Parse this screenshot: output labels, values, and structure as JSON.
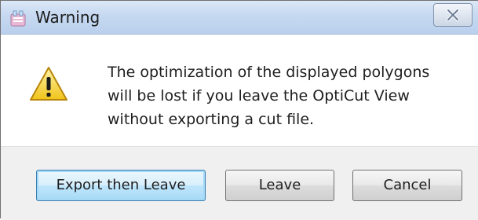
{
  "dialog": {
    "title": "Warning",
    "title_icon": "app-icon",
    "close_icon": "close-icon",
    "warning_icon": "warning-icon",
    "message": "The optimization of the displayed polygons\nwill be lost if you leave the OptiCut View\nwithout exporting a cut file."
  },
  "buttons": {
    "export_then_leave": "Export then Leave",
    "leave": "Leave",
    "cancel": "Cancel"
  },
  "colors": {
    "titlebar": "#c6d9f1",
    "footer": "#f0f0f0",
    "warning_fill": "#f7d33b",
    "default_button_border": "#3c7fb1"
  }
}
